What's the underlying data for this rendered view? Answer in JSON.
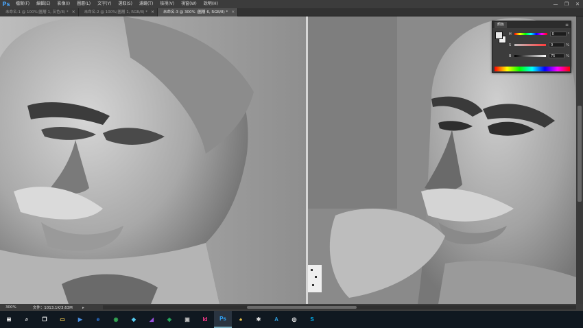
{
  "app": {
    "logo": "Ps"
  },
  "menu": [
    "檔案(F)",
    "編輯(E)",
    "影像(I)",
    "圖層(L)",
    "文字(Y)",
    "選取(S)",
    "濾鏡(T)",
    "檢視(V)",
    "視窗(W)",
    "說明(H)"
  ],
  "window_controls": [
    "—",
    "❐",
    "✕"
  ],
  "tabs": [
    {
      "label": "未命名-1 @ 100%(圖層 1, 灰色/8) *",
      "close": "×"
    },
    {
      "label": "未命名-2 @ 100%(圖層 1, RGB/8) *",
      "close": "×"
    },
    {
      "label": "未命名-3 @ 300% (圖層 6, RGB/8) *",
      "close": "×"
    }
  ],
  "active_tab": 2,
  "color_panel": {
    "tab_label": "顏色",
    "menu_icon": "≡",
    "sliders": [
      {
        "label": "H",
        "value": "0",
        "unit": "°"
      },
      {
        "label": "S",
        "value": "0",
        "unit": "%"
      },
      {
        "label": "B",
        "value": "75",
        "unit": "%"
      }
    ]
  },
  "status": {
    "zoom": "300%",
    "doc_info": "文件：1013.1K/3.63M",
    "arrow": "▸"
  },
  "taskbar": [
    {
      "name": "windows-start-icon",
      "glyph": "⊞",
      "color": "#ffffff"
    },
    {
      "name": "search-icon",
      "glyph": "⌕",
      "color": "#ffffff"
    },
    {
      "name": "task-view-icon",
      "glyph": "❐",
      "color": "#ffffff"
    },
    {
      "name": "file-explorer-icon",
      "glyph": "▭",
      "color": "#f2c94c"
    },
    {
      "name": "media-player-icon",
      "glyph": "▶",
      "color": "#4a90e2"
    },
    {
      "name": "edge-browser-icon",
      "glyph": "e",
      "color": "#2f80ed"
    },
    {
      "name": "chrome-browser-icon",
      "glyph": "◉",
      "color": "#34a853"
    },
    {
      "name": "app-icon-1",
      "glyph": "◆",
      "color": "#56ccf2"
    },
    {
      "name": "app-icon-2",
      "glyph": "◢",
      "color": "#9b51e0"
    },
    {
      "name": "app-icon-3",
      "glyph": "◈",
      "color": "#27ae60"
    },
    {
      "name": "app-icon-4",
      "glyph": "▣",
      "color": "#bdbdbd"
    },
    {
      "name": "indesign-icon",
      "glyph": "Id",
      "color": "#ff3a8c"
    },
    {
      "name": "photoshop-icon",
      "glyph": "Ps",
      "color": "#31a8ff"
    },
    {
      "name": "app-icon-5",
      "glyph": "♠",
      "color": "#f2c94c"
    },
    {
      "name": "app-icon-6",
      "glyph": "✱",
      "color": "#e0e0e0"
    },
    {
      "name": "app-icon-7",
      "glyph": "A",
      "color": "#2d9cdb"
    },
    {
      "name": "app-icon-8",
      "glyph": "◎",
      "color": "#ffffff"
    },
    {
      "name": "skype-icon",
      "glyph": "S",
      "color": "#00aff0"
    }
  ],
  "active_taskbar_index": 12
}
